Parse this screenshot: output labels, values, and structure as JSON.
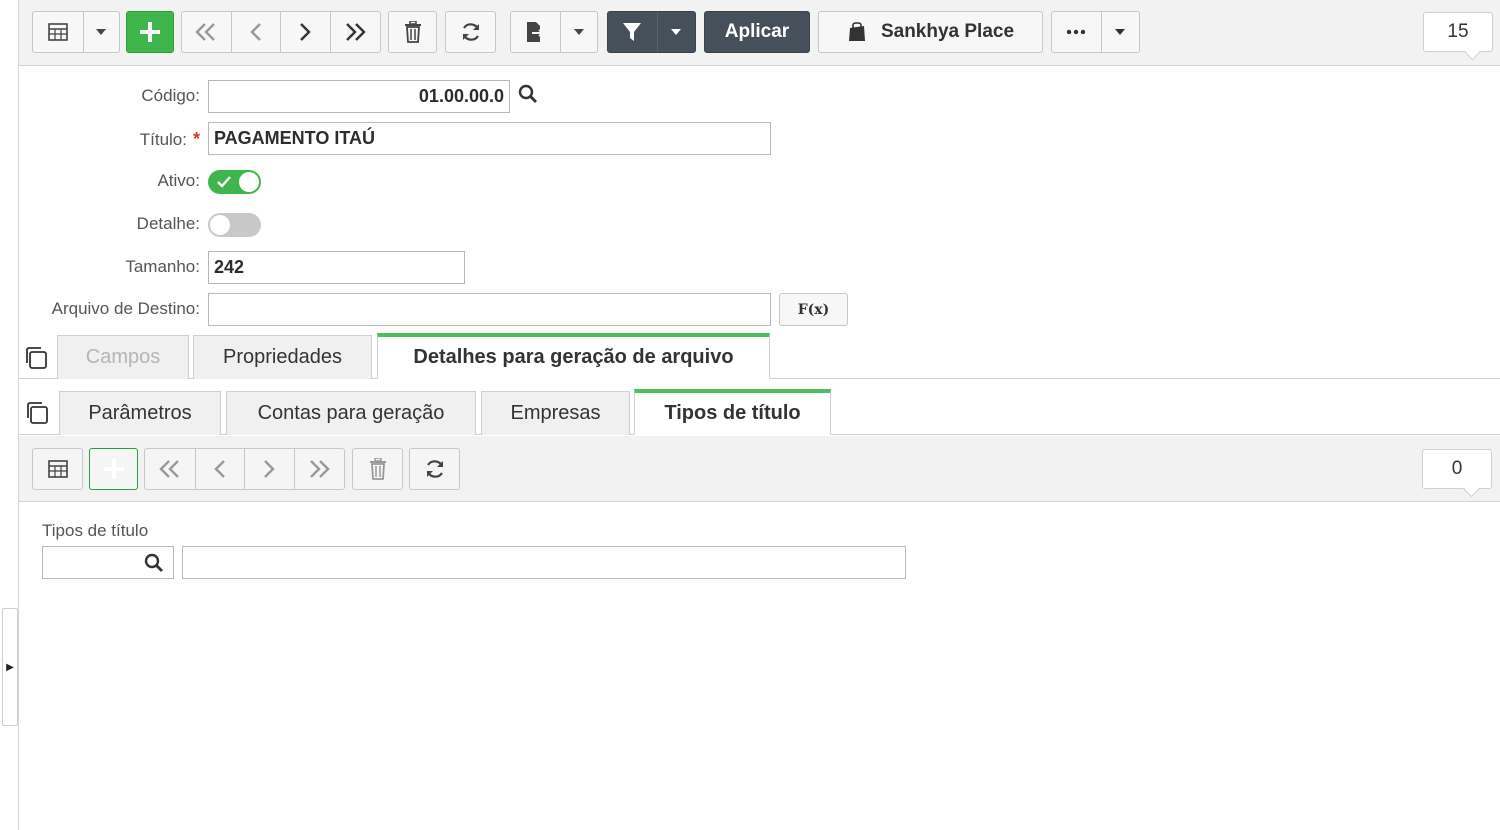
{
  "toolbar": {
    "apply_label": "Aplicar",
    "place_label": "Sankhya Place",
    "record_count": "15",
    "icons": [
      "grid-icon",
      "chevron-down-icon",
      "plus-icon",
      "first-record-icon",
      "previous-record-icon",
      "next-record-icon",
      "last-record-icon",
      "trash-icon",
      "refresh-icon",
      "export-icon",
      "filter-icon",
      "bag-icon",
      "more-icon"
    ]
  },
  "form": {
    "codigo_label": "Código:",
    "codigo_value": "01.00.00.0",
    "titulo_label": "Título:",
    "titulo_required": "*",
    "titulo_value": "PAGAMENTO ITAÚ",
    "ativo_label": "Ativo:",
    "ativo_on": true,
    "detalhe_label": "Detalhe:",
    "detalhe_on": false,
    "tamanho_label": "Tamanho:",
    "tamanho_value": "242",
    "arquivo_label": "Arquivo de Destino:",
    "arquivo_value": "",
    "fx_label": "F(x)"
  },
  "main_tabs": [
    {
      "label": "Campos",
      "state": "disabled"
    },
    {
      "label": "Propriedades",
      "state": "normal"
    },
    {
      "label": "Detalhes para geração de arquivo",
      "state": "active"
    }
  ],
  "sub_tabs": [
    {
      "label": "Parâmetros",
      "state": "normal"
    },
    {
      "label": "Contas para geração",
      "state": "normal"
    },
    {
      "label": "Empresas",
      "state": "normal"
    },
    {
      "label": "Tipos de título",
      "state": "active"
    }
  ],
  "sub_toolbar": {
    "record_count": "0"
  },
  "detail": {
    "field_label": "Tipos de título",
    "code_value": "",
    "desc_value": ""
  },
  "sidebar_toggle": "▶",
  "colors": {
    "accent_green": "#3fb64b",
    "dark_button": "#46505b",
    "required_red": "#d9362b"
  }
}
